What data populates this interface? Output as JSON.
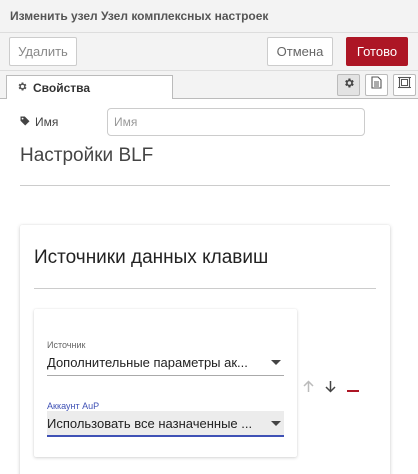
{
  "window": {
    "title": "Изменить узел Узел комплексных настроек"
  },
  "toolbar": {
    "delete_label": "Удалить",
    "cancel_label": "Отмена",
    "done_label": "Готово"
  },
  "tabs": {
    "properties_label": "Свойства"
  },
  "form": {
    "name_label": "Имя",
    "name_placeholder": "Имя",
    "name_value": "",
    "section_title": "Настройки BLF"
  },
  "card": {
    "title": "Источники данных клавиш",
    "source_label": "Источник",
    "source_value": "Дополнительные параметры ак...",
    "account_label": "Аккаунт AuP",
    "account_value": "Использовать все назначенные ..."
  },
  "colors": {
    "accent": "#ad1625",
    "focus": "#3f51b5",
    "remove": "#ad1625"
  },
  "icons": [
    "gear-icon",
    "tag-icon",
    "document-icon",
    "layout-icon",
    "arrow-up-icon",
    "arrow-down-icon",
    "minus-icon",
    "caret-down-icon"
  ]
}
